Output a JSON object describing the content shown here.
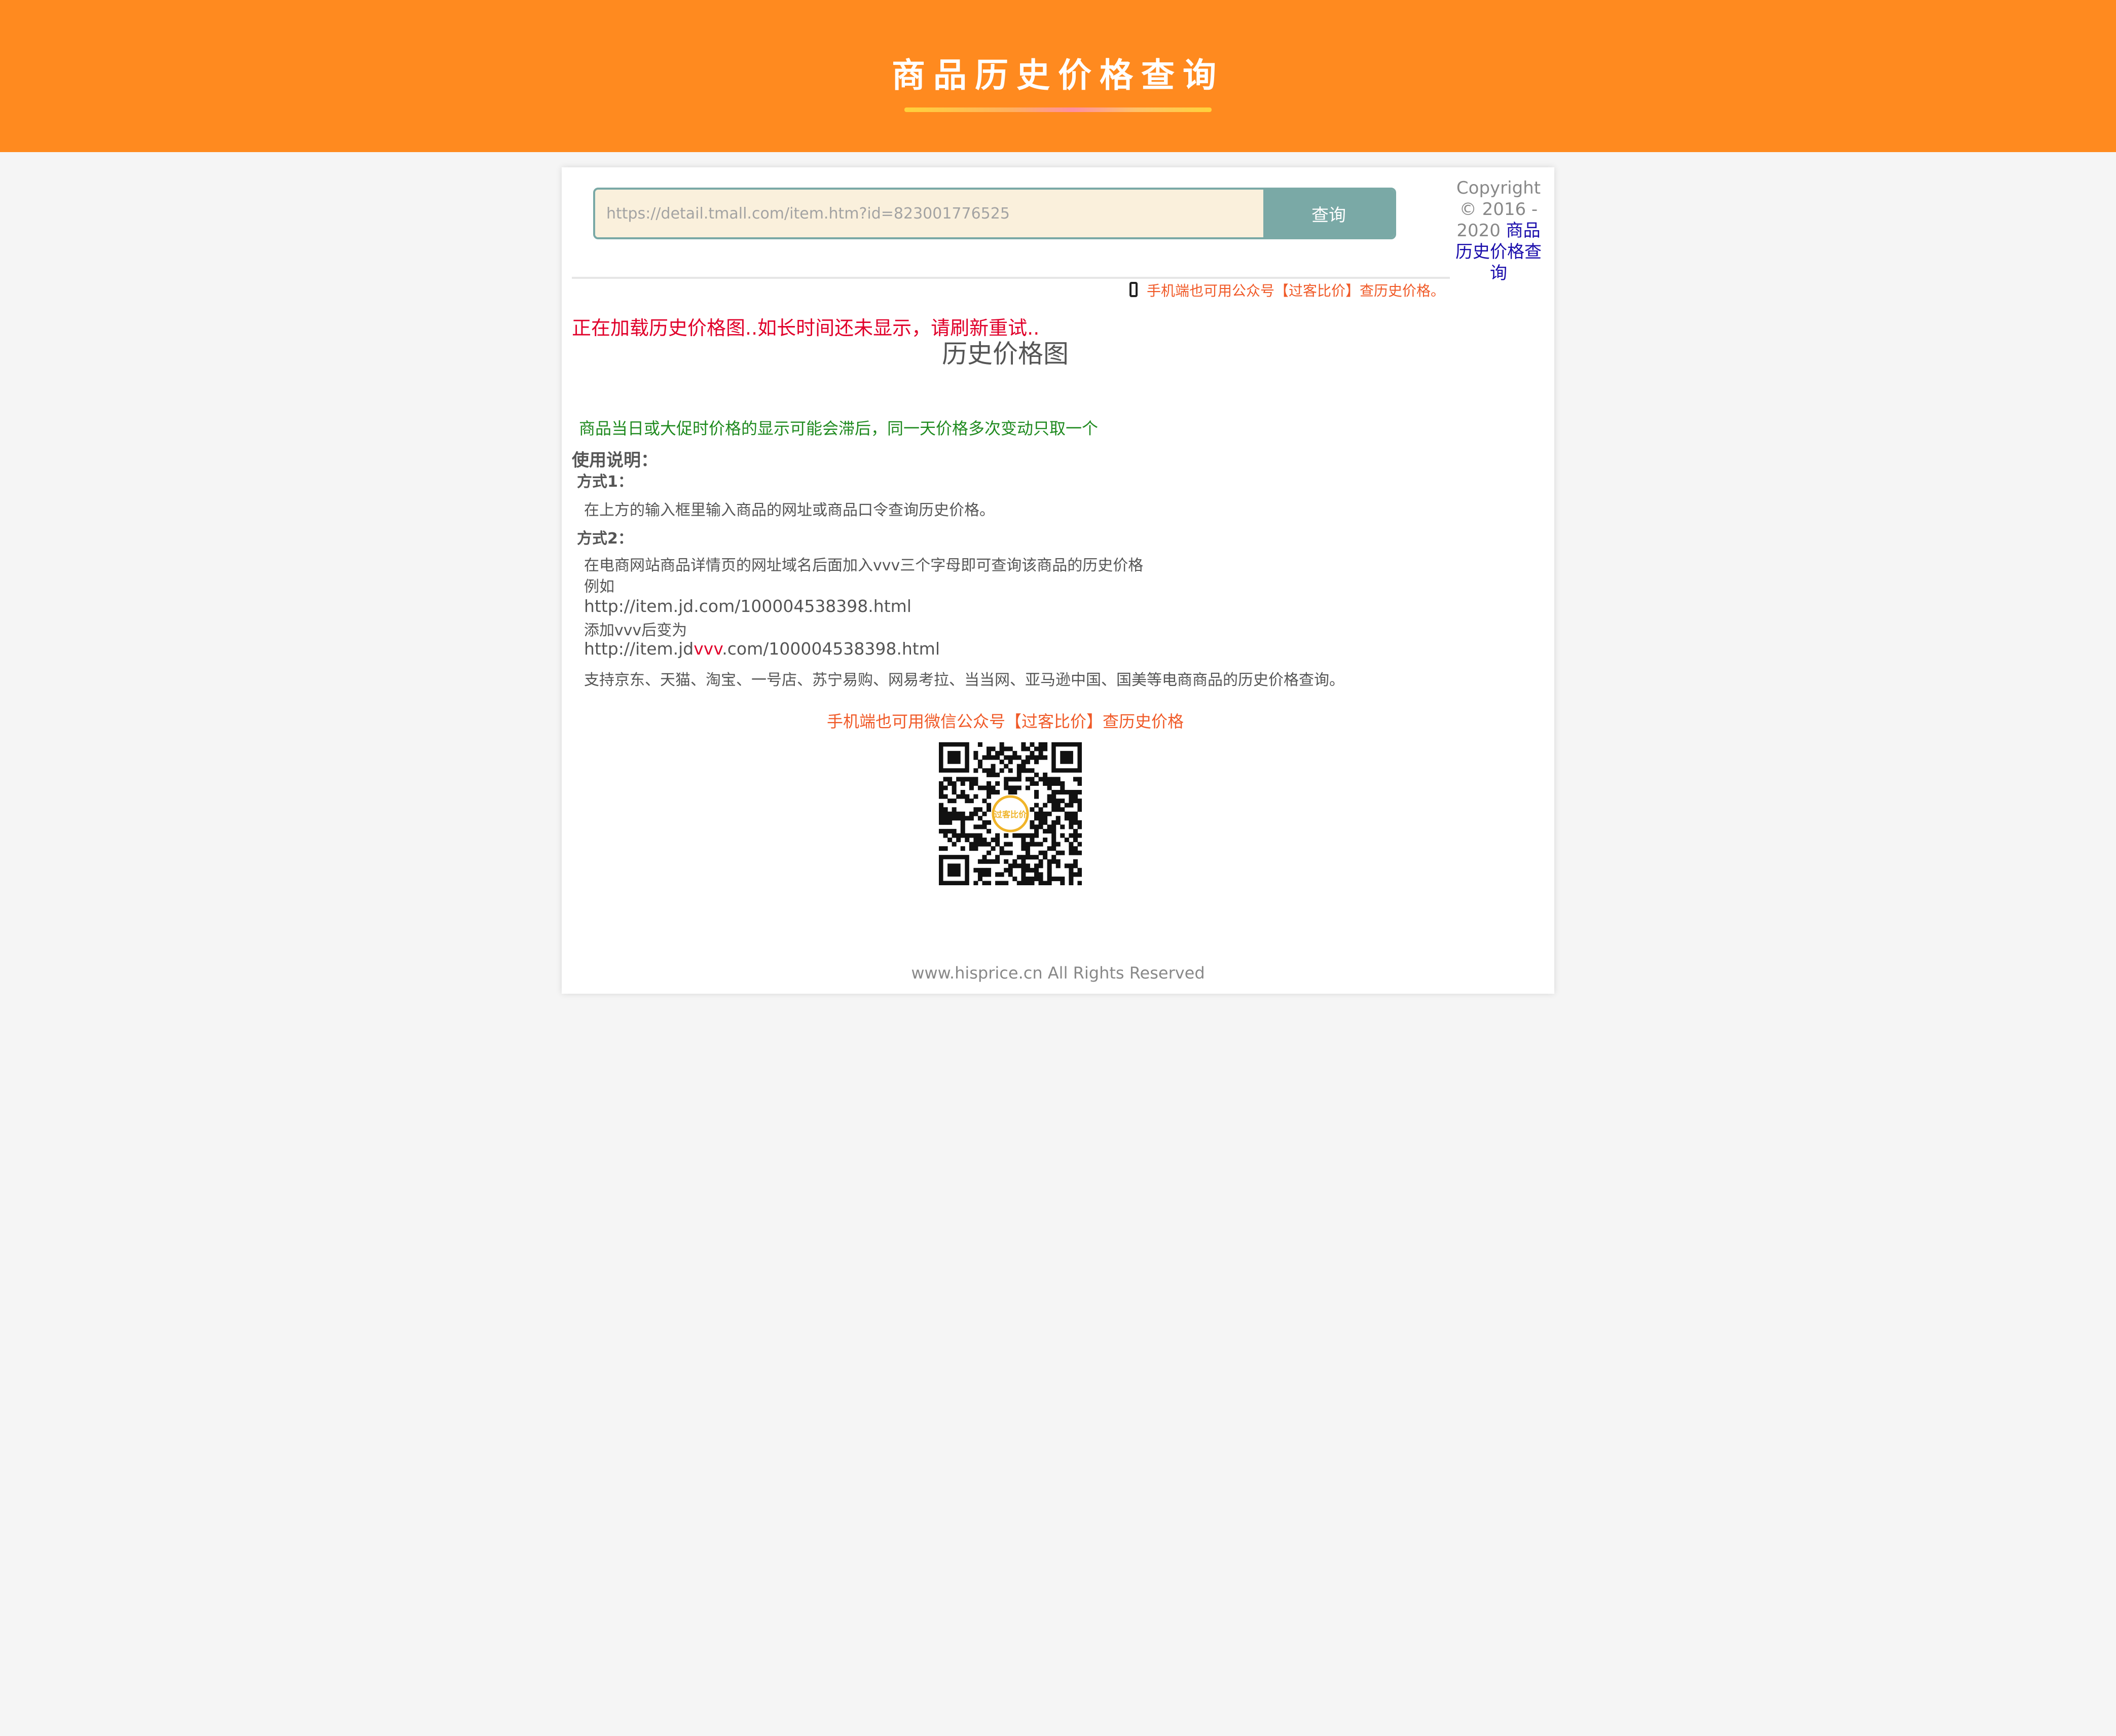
{
  "header": {
    "title": "商品历史价格查询"
  },
  "search": {
    "placeholder": "https://detail.tmall.com/item.htm?id=823001776525",
    "button_label": "查询"
  },
  "sidebar": {
    "copyright_prefix": "Copyright © 2016 - 2020",
    "copyright_link": "商品历史价格查询"
  },
  "mobile_tip": "手机端也可用公众号【过客比价】查历史价格。",
  "loading_message": "正在加载历史价格图..如长时间还未显示，请刷新重试..",
  "chart_title": "历史价格图",
  "notice": "商品当日或大促时价格的显示可能会滞后，同一天价格多次变动只取一个",
  "usage": {
    "title": "使用说明：",
    "method1_title": "方式1：",
    "method1_text": "在上方的输入框里输入商品的网址或商品口令查询历史价格。",
    "method2_title": "方式2：",
    "method2_line1": "在电商网站商品详情页的网址域名后面加入vvv三个字母即可查询该商品的历史价格",
    "method2_line2": "例如",
    "method2_url_before": "http://item.jd.com/100004538398.html",
    "method2_line3": "添加vvv后变为",
    "method2_url_after_prefix": "http://item.jd",
    "method2_url_after_highlight": "vvv",
    "method2_url_after_suffix": ".com/100004538398.html",
    "supported": "支持京东、天猫、淘宝、一号店、苏宁易购、网易考拉、当当网、亚马逊中国、国美等电商商品的历史价格查询。"
  },
  "wechat_tip": "手机端也可用微信公众号【过客比价】查历史价格",
  "qr_code": {
    "center_logo_text": "过客比价",
    "colors": {
      "module": "#111111",
      "logo": "#f0b429"
    }
  },
  "footer": "www.hisprice.cn All Rights Reserved"
}
